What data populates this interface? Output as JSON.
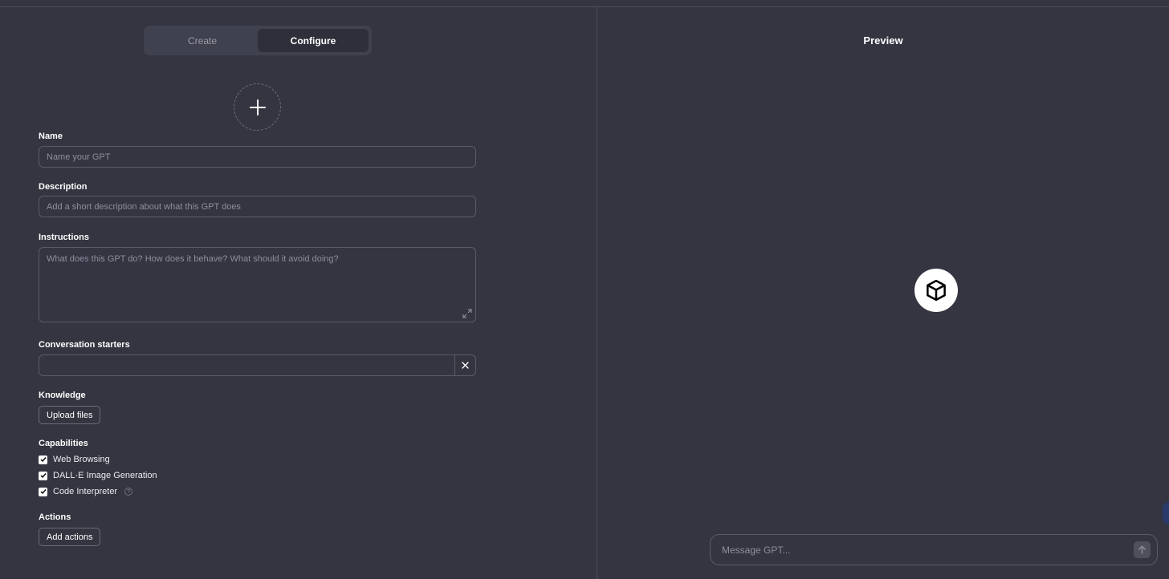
{
  "tabs": [
    {
      "label": "Create",
      "active": false
    },
    {
      "label": "Configure",
      "active": true
    }
  ],
  "form": {
    "name_label": "Name",
    "name_placeholder": "Name your GPT",
    "description_label": "Description",
    "description_placeholder": "Add a short description about what this GPT does",
    "instructions_label": "Instructions",
    "instructions_placeholder": "What does this GPT do? How does it behave? What should it avoid doing?",
    "starters_label": "Conversation starters",
    "starters_value": "",
    "knowledge_label": "Knowledge",
    "upload_label": "Upload files",
    "capabilities_label": "Capabilities",
    "capabilities": [
      {
        "label": "Web Browsing",
        "checked": true
      },
      {
        "label": "DALL·E Image Generation",
        "checked": true
      },
      {
        "label": "Code Interpreter",
        "checked": true,
        "help": "?"
      }
    ],
    "actions_label": "Actions",
    "add_actions_label": "Add actions"
  },
  "preview": {
    "title": "Preview",
    "message_placeholder": "Message GPT..."
  },
  "icons": {
    "avatar": "plus-icon",
    "logo": "cube-icon",
    "send": "arrow-up-icon",
    "expand": "expand-icon",
    "clear": "close-icon"
  },
  "colors": {
    "background": "#343541",
    "tab_track": "#40414f",
    "tab_active": "#2e2f3a",
    "border": "#5a5b67"
  }
}
